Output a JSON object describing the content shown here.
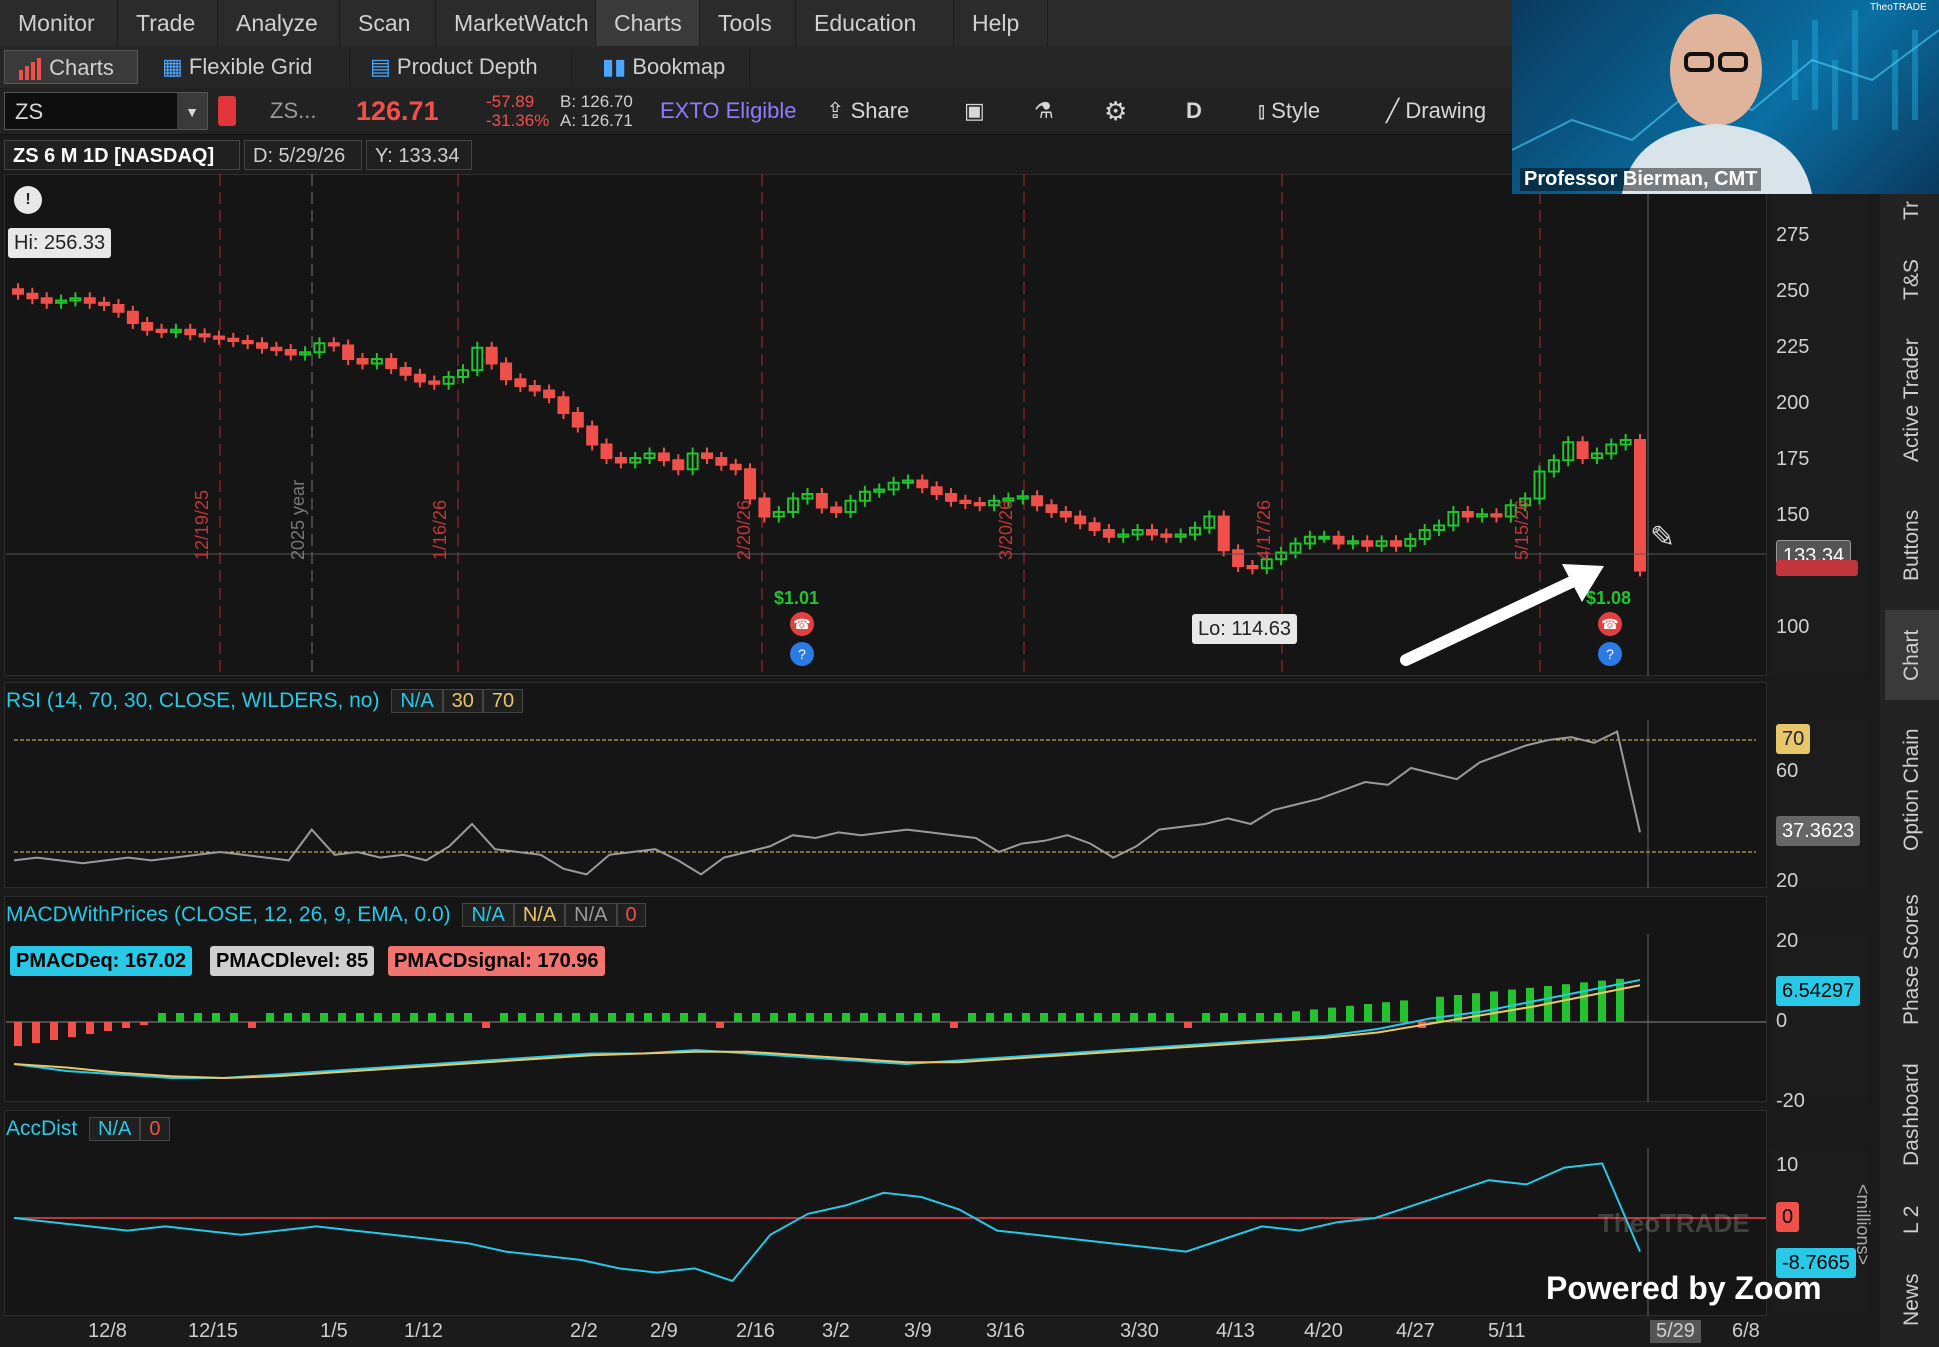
{
  "menu": [
    "Monitor",
    "Trade",
    "Analyze",
    "Scan",
    "MarketWatch",
    "Charts",
    "Tools",
    "Education",
    "Help"
  ],
  "menu_active": "Charts",
  "subtabs": [
    "Charts",
    "Flexible Grid",
    "Product Depth",
    "Bookmap"
  ],
  "toolbar": {
    "symbol": "ZS",
    "symbol_desc": "ZS...",
    "last": "126.71",
    "change": "-57.89",
    "change_pct": "-31.36%",
    "bid": "B: 126.70",
    "ask": "A: 126.71",
    "exto": "EXTO Eligible",
    "share": "Share",
    "period": "D",
    "style": "Style",
    "drawing": "Drawing"
  },
  "header": {
    "title": "ZS 6 M 1D [NASDAQ]",
    "date": "D: 5/29/26",
    "y": "Y: 133.34"
  },
  "video": {
    "presenter": "Professor Bierman, CMT",
    "brand": "TheoTRADE"
  },
  "price_pane": {
    "hi_label": "Hi: 256.33",
    "lo_label": "Lo: 114.63",
    "dividend_left": "$1.01",
    "dividend_right": "$1.08",
    "y_ticks": [
      "275",
      "250",
      "225",
      "200",
      "175",
      "150",
      "100"
    ],
    "current_price_badge": "133.34",
    "vertical_labels": [
      "12/19/25",
      "2025 year",
      "1/16/26",
      "2/20/26",
      "3/20/26",
      "4/17/26",
      "5/15/26"
    ]
  },
  "rsi_pane": {
    "title": "RSI (14, 70, 30, CLOSE, WILDERS, no)",
    "val1": "N/A",
    "val2": "30",
    "val3": "70",
    "y_ticks": [
      "70",
      "60",
      "20"
    ],
    "badge": "37.3623"
  },
  "macd_pane": {
    "title": "MACDWithPrices (CLOSE, 12, 26, 9, EMA, 0.0)",
    "vals": [
      "N/A",
      "N/A",
      "N/A",
      "0"
    ],
    "pmacdeq": "PMACDeq: 167.02",
    "pmacdlevel": "PMACDlevel: 85",
    "pmacdsignal": "PMACDsignal: 170.96",
    "y_ticks": [
      "20",
      "0",
      "-20"
    ],
    "badge": "6.54297"
  },
  "accdist_pane": {
    "title": "AccDist",
    "vals": [
      "N/A",
      "0"
    ],
    "y_ticks": [
      "10",
      "0"
    ],
    "badge": "-8.7665",
    "unit": "<millions>"
  },
  "x_axis": [
    "12/8",
    "12/15",
    "1/5",
    "1/12",
    "2/2",
    "2/9",
    "2/16",
    "3/2",
    "3/9",
    "3/16",
    "3/30",
    "4/13",
    "4/20",
    "4/27",
    "5/11",
    "5/29",
    "6/8"
  ],
  "right_tabs": [
    "Tr",
    "T&S",
    "Active Trader",
    "Buttons",
    "Chart",
    "Option Chain",
    "Phase Scores",
    "Dashboard",
    "L 2",
    "News"
  ],
  "watermark": "Powered by Zoom",
  "colors": {
    "up": "#22c32e",
    "down": "#f0504a",
    "cyan": "#27c9e6",
    "gold": "#e8c76a"
  }
}
